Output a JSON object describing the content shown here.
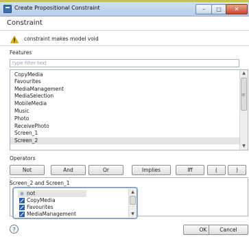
{
  "window": {
    "title": "Create Propositional Constraint",
    "minimize_glyph": "–",
    "maximize_glyph": "□",
    "close_glyph": "✕"
  },
  "header": {
    "section_title": "Constraint",
    "warning_text": "constraint makes model void",
    "warning_icon": "warning-icon",
    "warning_color": "#e0b400"
  },
  "features": {
    "label": "Features",
    "filter_placeholder": "type filter text",
    "items": [
      "CopyMedia",
      "Favourites",
      "MediaManagement",
      "MediaSelection",
      "MobileMedia",
      "Music",
      "Photo",
      "ReceivePhoto",
      "Screen_1",
      "Screen_2"
    ],
    "selected_item": "Screen_2"
  },
  "operators": {
    "label": "Operators",
    "buttons": [
      "Not",
      "And",
      "Or",
      "Implies",
      "Iff",
      "(",
      ")"
    ]
  },
  "expression": {
    "text": "Screen_2 and Screen_1"
  },
  "autocomplete": {
    "items": [
      {
        "label": "not",
        "icon": "keyword-dot-icon"
      },
      {
        "label": "CopyMedia",
        "icon": "feature-icon"
      },
      {
        "label": "Favourites",
        "icon": "feature-icon"
      },
      {
        "label": "MediaManagement",
        "icon": "feature-icon"
      }
    ],
    "selected_item": "not"
  },
  "footer": {
    "help_glyph": "?",
    "ok_label": "OK",
    "cancel_label": "Cancel"
  },
  "colors": {
    "accent_blue": "#3a6fb0",
    "selection_gray": "#e4e4e4"
  }
}
